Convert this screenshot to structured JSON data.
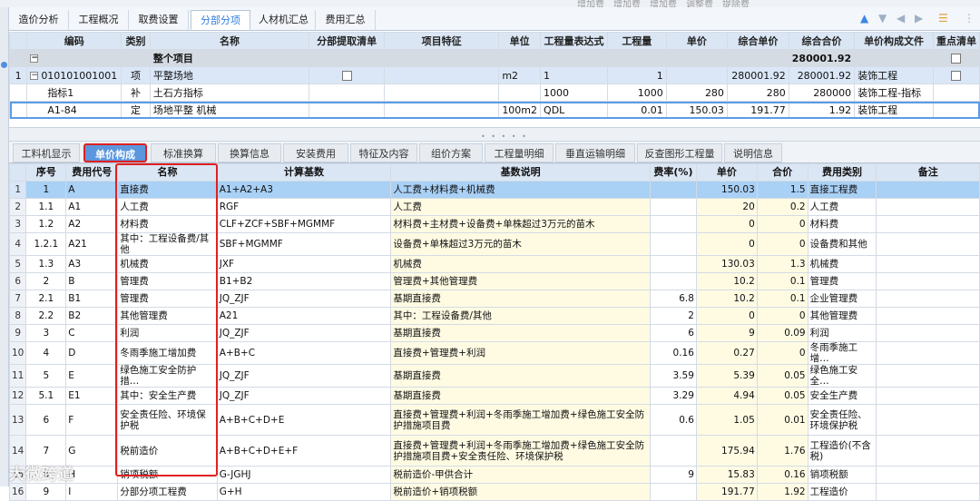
{
  "top_toolbar": [
    "增加费",
    "增加费",
    "增加费",
    "调整费",
    "提除费"
  ],
  "tabs": [
    {
      "label": "造价分析",
      "active": false
    },
    {
      "label": "工程概况",
      "active": false
    },
    {
      "label": "取费设置",
      "active": false
    },
    {
      "label": "分部分项",
      "active": true
    },
    {
      "label": "人材机汇总",
      "active": false
    },
    {
      "label": "费用汇总",
      "active": false
    }
  ],
  "toolbar_icons": [
    "arrow-up-icon",
    "arrow-down-icon",
    "arrow-left-icon",
    "arrow-right-icon",
    "filter-icon",
    "more-icon"
  ],
  "upper_grid": {
    "headers": [
      "编码",
      "类别",
      "名称",
      "分部提取清单",
      "项目特征",
      "单位",
      "工程量表达式",
      "工程量",
      "单价",
      "综合单价",
      "综合合价",
      "单价构成文件",
      "重点清单"
    ],
    "group_row": {
      "name": "整个项目",
      "total": "280001.92"
    },
    "rows": [
      {
        "no": "1",
        "code": "010101001001",
        "cat": "项",
        "name": "平整场地",
        "unit": "m2",
        "expr": "1",
        "qty": "1",
        "price": "",
        "unit_total": "280001.92",
        "total": "280001.92",
        "file": "装饰工程"
      },
      {
        "no": "",
        "code": "指标1",
        "cat": "补",
        "name": "土石方指标",
        "unit": "",
        "expr": "1000",
        "qty": "1000",
        "price": "280",
        "unit_total": "280",
        "total": "280000",
        "file": "装饰工程-指标"
      },
      {
        "no": "",
        "code": "A1-84",
        "cat": "定",
        "name": "场地平整 机械",
        "unit": "100m2",
        "expr": "QDL",
        "qty": "0.01",
        "price": "150.03",
        "unit_total": "191.77",
        "total": "1.92",
        "file": "装饰工程"
      }
    ]
  },
  "bottom_tabs": [
    {
      "label": "工料机显示",
      "active": false
    },
    {
      "label": "单价构成",
      "active": true
    },
    {
      "label": "标准换算",
      "active": false
    },
    {
      "label": "换算信息",
      "active": false
    },
    {
      "label": "安装费用",
      "active": false
    },
    {
      "label": "特征及内容",
      "active": false
    },
    {
      "label": "组价方案",
      "active": false
    },
    {
      "label": "工程量明细",
      "active": false
    },
    {
      "label": "垂直运输明细",
      "active": false
    },
    {
      "label": "反查图形工程量",
      "active": false
    },
    {
      "label": "说明信息",
      "active": false
    }
  ],
  "lower_grid": {
    "headers": [
      "序号",
      "费用代号",
      "名称",
      "计算基数",
      "基数说明",
      "费率(%)",
      "单价",
      "合价",
      "费用类别",
      "备注"
    ],
    "rows": [
      {
        "rn": "1",
        "seq": "1",
        "code": "A",
        "name": "直接费",
        "base": "A1+A2+A3",
        "desc": "人工费+材料费+机械费",
        "rate": "",
        "price": "150.03",
        "total": "1.5",
        "type": "直接工程费",
        "note": ""
      },
      {
        "rn": "2",
        "seq": "1.1",
        "code": "A1",
        "name": "人工费",
        "base": "RGF",
        "desc": "人工费",
        "rate": "",
        "price": "20",
        "total": "0.2",
        "type": "人工费",
        "note": ""
      },
      {
        "rn": "3",
        "seq": "1.2",
        "code": "A2",
        "name": "材料费",
        "base": "CLF+ZCF+SBF+MGMMF",
        "desc": "材料费+主材费+设备费+单株超过3万元的苗木",
        "rate": "",
        "price": "0",
        "total": "0",
        "type": "材料费",
        "note": ""
      },
      {
        "rn": "4",
        "seq": "1.2.1",
        "code": "A21",
        "name": "其中：工程设备费/其他",
        "base": "SBF+MGMMF",
        "desc": "设备费+单株超过3万元的苗木",
        "rate": "",
        "price": "0",
        "total": "0",
        "type": "设备费和其他",
        "note": ""
      },
      {
        "rn": "5",
        "seq": "1.3",
        "code": "A3",
        "name": "机械费",
        "base": "JXF",
        "desc": "机械费",
        "rate": "",
        "price": "130.03",
        "total": "1.3",
        "type": "机械费",
        "note": ""
      },
      {
        "rn": "6",
        "seq": "2",
        "code": "B",
        "name": "管理费",
        "base": "B1+B2",
        "desc": "管理费+其他管理费",
        "rate": "",
        "price": "10.2",
        "total": "0.1",
        "type": "管理费",
        "note": ""
      },
      {
        "rn": "7",
        "seq": "2.1",
        "code": "B1",
        "name": "管理费",
        "base": "JQ_ZJF",
        "desc": "基期直接费",
        "rate": "6.8",
        "price": "10.2",
        "total": "0.1",
        "type": "企业管理费",
        "note": ""
      },
      {
        "rn": "8",
        "seq": "2.2",
        "code": "B2",
        "name": "其他管理费",
        "base": "A21",
        "desc": "其中：工程设备费/其他",
        "rate": "2",
        "price": "0",
        "total": "0",
        "type": "其他管理费",
        "note": ""
      },
      {
        "rn": "9",
        "seq": "3",
        "code": "C",
        "name": "利润",
        "base": "JQ_ZJF",
        "desc": "基期直接费",
        "rate": "6",
        "price": "9",
        "total": "0.09",
        "type": "利润",
        "note": ""
      },
      {
        "rn": "10",
        "seq": "4",
        "code": "D",
        "name": "冬雨季施工增加费",
        "base": "A+B+C",
        "desc": "直接费+管理费+利润",
        "rate": "0.16",
        "price": "0.27",
        "total": "0",
        "type": "冬雨季施工增…",
        "note": ""
      },
      {
        "rn": "11",
        "seq": "5",
        "code": "E",
        "name": "绿色施工安全防护措…",
        "base": "JQ_ZJF",
        "desc": "基期直接费",
        "rate": "3.59",
        "price": "5.39",
        "total": "0.05",
        "type": "绿色施工安全…",
        "note": ""
      },
      {
        "rn": "12",
        "seq": "5.1",
        "code": "E1",
        "name": "其中：安全生产费",
        "base": "JQ_ZJF",
        "desc": "基期直接费",
        "rate": "3.29",
        "price": "4.94",
        "total": "0.05",
        "type": "安全生产费",
        "note": ""
      },
      {
        "rn": "13",
        "seq": "6",
        "code": "F",
        "name": "安全责任险、环境保护税",
        "base": "A+B+C+D+E",
        "desc": "直接费+管理费+利润+冬雨季施工增加费+绿色施工安全防护措施项目费",
        "rate": "0.6",
        "price": "1.05",
        "total": "0.01",
        "type": "安全责任险、环境保护税",
        "note": ""
      },
      {
        "rn": "14",
        "seq": "7",
        "code": "G",
        "name": "税前造价",
        "base": "A+B+C+D+E+F",
        "desc": "直接费+管理费+利润+冬雨季施工增加费+绿色施工安全防护措施项目费+安全责任险、环境保护税",
        "rate": "",
        "price": "175.94",
        "total": "1.76",
        "type": "工程造价(不含税)",
        "note": ""
      },
      {
        "rn": "15",
        "seq": "8",
        "code": "H",
        "name": "销项税额",
        "base": "G-JGHJ",
        "desc": "税前造价-甲供合计",
        "rate": "9",
        "price": "15.83",
        "total": "0.16",
        "type": "销项税额",
        "note": ""
      },
      {
        "rn": "16",
        "seq": "9",
        "code": "I",
        "name": "分部分项工程费",
        "base": "G+H",
        "desc": "税前造价+销项税额",
        "rate": "",
        "price": "191.77",
        "total": "1.92",
        "type": "工程造价",
        "note": ""
      }
    ]
  },
  "watermark": "大微跨道"
}
